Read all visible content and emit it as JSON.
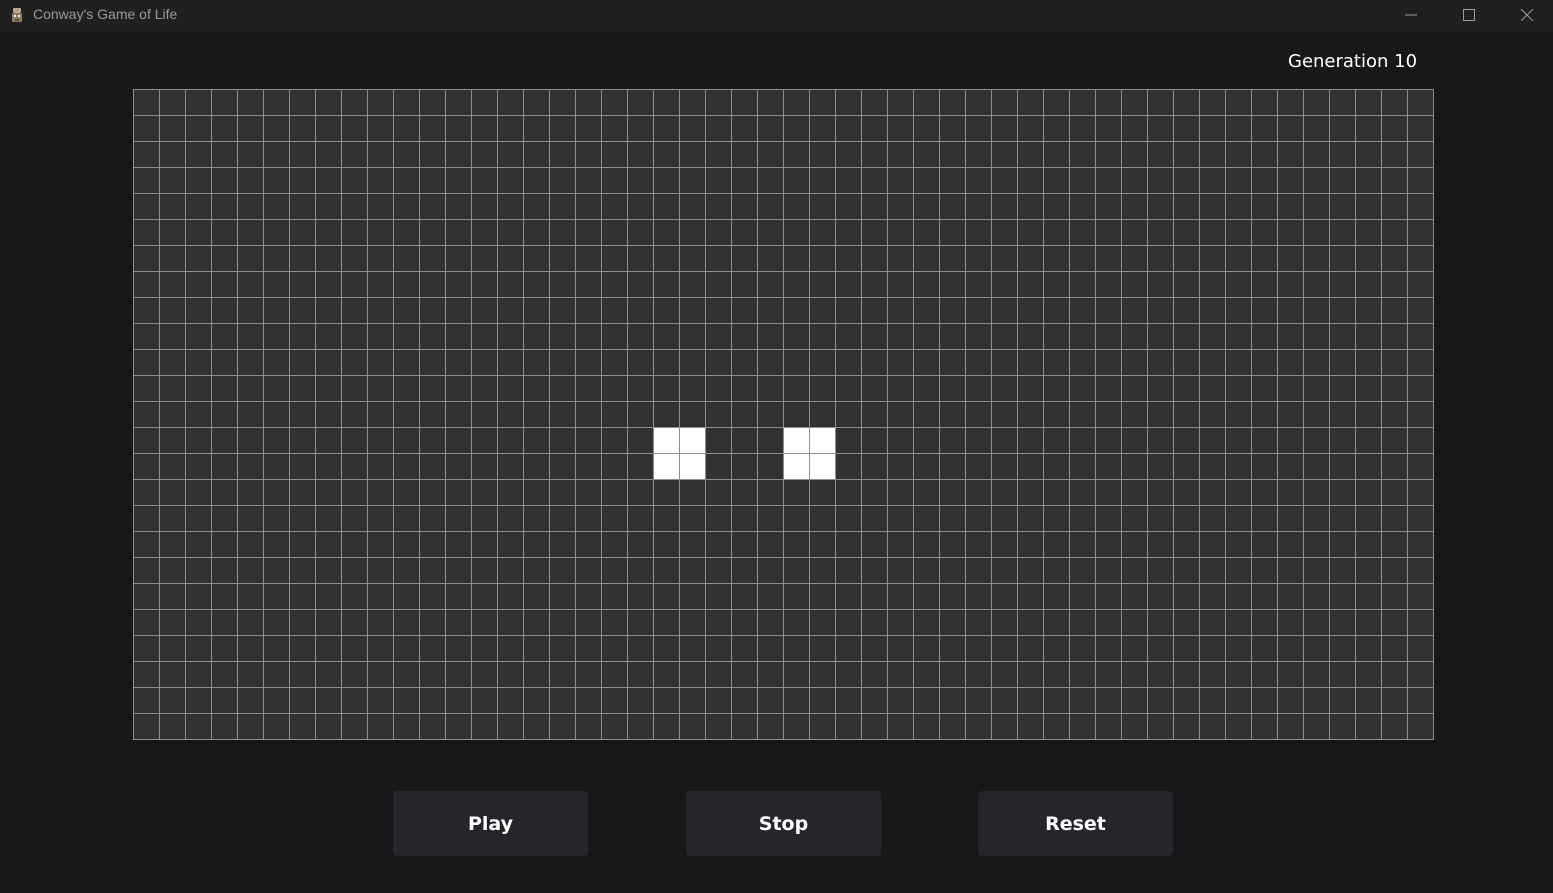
{
  "window": {
    "title": "Conway's Game of Life",
    "icon": "app-icon",
    "controls": [
      "minimize-icon",
      "maximize-icon",
      "close-icon"
    ]
  },
  "game": {
    "generation_label": "Generation 10",
    "grid": {
      "cols": 50,
      "rows": 25,
      "live_cells": [
        {
          "col": 20,
          "row": 13
        },
        {
          "col": 21,
          "row": 13
        },
        {
          "col": 20,
          "row": 14
        },
        {
          "col": 21,
          "row": 14
        },
        {
          "col": 25,
          "row": 13
        },
        {
          "col": 26,
          "row": 13
        },
        {
          "col": 25,
          "row": 14
        },
        {
          "col": 26,
          "row": 14
        }
      ]
    }
  },
  "controls": {
    "play_label": "Play",
    "stop_label": "Stop",
    "reset_label": "Reset"
  },
  "colors": {
    "background": "#181818",
    "titlebar": "#202020",
    "board": "#323232",
    "grid_lines": "#8e8e8e",
    "live_cell": "#ffffff",
    "button": "#24262c",
    "text": "#ffffff"
  }
}
